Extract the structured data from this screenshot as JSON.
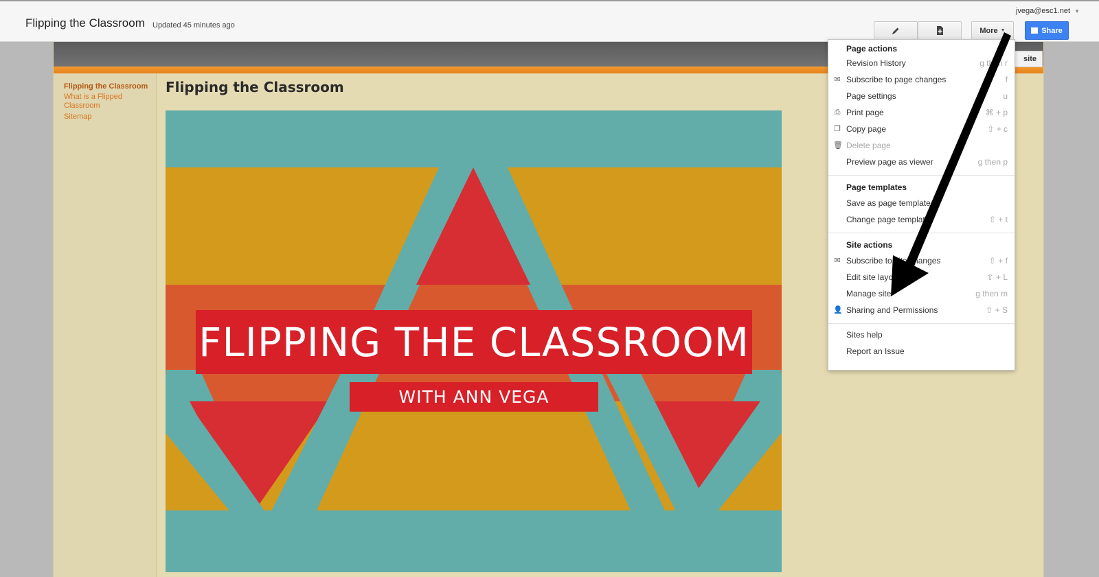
{
  "topbar": {
    "site_title": "Flipping the Classroom",
    "updated": "Updated 45 minutes ago",
    "user_email": "jvega@esc1.net",
    "edit_icon": "pencil-icon",
    "new_page_icon": "new-page-icon",
    "more_label": "More",
    "share_label": "Share"
  },
  "site_header": {
    "manage_site_peek": "site"
  },
  "sidebar": {
    "items": [
      {
        "label": "Flipping the Classroom"
      },
      {
        "label": "What is a Flipped Classroom"
      },
      {
        "label": "Sitemap"
      }
    ]
  },
  "main": {
    "heading": "Flipping the Classroom",
    "hero": {
      "title": "FLIPPING THE CLASSROOM",
      "subtitle": "WITH ANN VEGA"
    }
  },
  "menu": {
    "page_actions": {
      "heading": "Page actions",
      "items": [
        {
          "label": "Revision History",
          "shortcut": "g then r",
          "icon": ""
        },
        {
          "label": "Subscribe to page changes",
          "shortcut": "f",
          "icon": "envelope-icon"
        },
        {
          "label": "Page settings",
          "shortcut": "u",
          "icon": ""
        },
        {
          "label": "Print page",
          "shortcut": "⌘ + p",
          "icon": "printer-icon"
        },
        {
          "label": "Copy page",
          "shortcut": "⇧ + c",
          "icon": "copy-icon"
        },
        {
          "label": "Delete page",
          "shortcut": "",
          "icon": "trash-icon"
        },
        {
          "label": "Preview page as viewer",
          "shortcut": "g then p",
          "icon": ""
        }
      ]
    },
    "page_templates": {
      "heading": "Page templates",
      "items": [
        {
          "label": "Save as page template",
          "shortcut": ""
        },
        {
          "label": "Change page template",
          "shortcut": "⇧ + t"
        }
      ]
    },
    "site_actions": {
      "heading": "Site actions",
      "items": [
        {
          "label": "Subscribe to site changes",
          "shortcut": "⇧ + f",
          "icon": "envelope-icon"
        },
        {
          "label": "Edit site layout",
          "shortcut": "⇧ + L",
          "icon": ""
        },
        {
          "label": "Manage site",
          "shortcut": "g then m",
          "icon": ""
        },
        {
          "label": "Sharing and Permissions",
          "shortcut": "⇧ + S",
          "icon": "add-person-icon"
        }
      ]
    },
    "help": {
      "items": [
        {
          "label": "Sites help"
        },
        {
          "label": "Report an Issue"
        }
      ]
    }
  },
  "colors": {
    "share_blue": "#3d82f3",
    "header_orange": "#f29a2e",
    "hero_teal": "#62ada9",
    "hero_gold": "#d39a1c",
    "hero_red": "#d72028",
    "link_orange": "#d8741e",
    "arrow": "#000000"
  }
}
